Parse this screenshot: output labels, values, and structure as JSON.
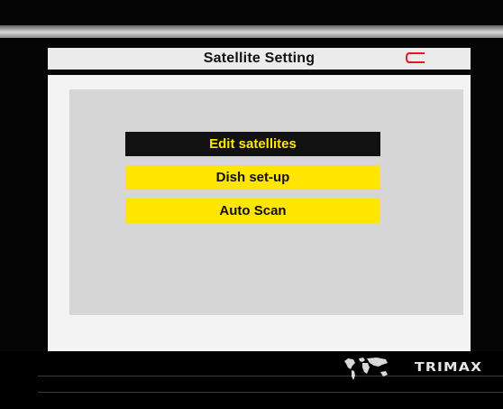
{
  "screen": {
    "title": "Satellite Setting",
    "back_icon": "back-arrow-icon",
    "colors": {
      "accent_yellow": "#ffe600",
      "selected_bg": "#111111",
      "back_icon_red": "#e01a1a"
    }
  },
  "menu": {
    "items": [
      {
        "label": "Edit satellites",
        "selected": true
      },
      {
        "label": "Dish set-up",
        "selected": false
      },
      {
        "label": "Auto Scan",
        "selected": false
      }
    ]
  },
  "footer": {
    "map_icon": "world-map-icon",
    "brand": "TRIMAX"
  }
}
